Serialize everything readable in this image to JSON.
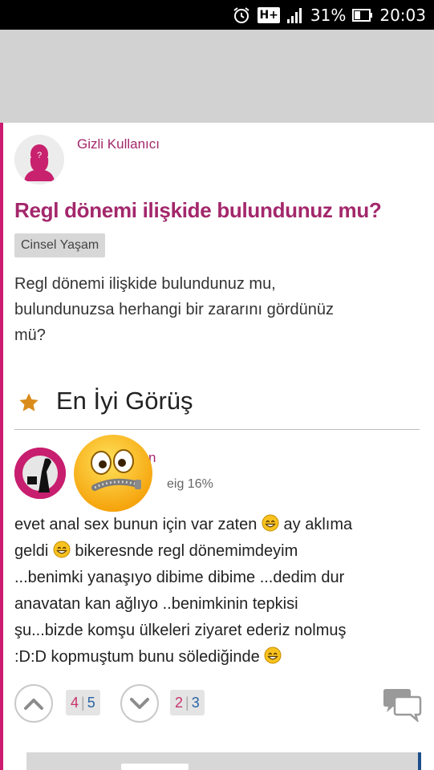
{
  "status_bar": {
    "network": "H+",
    "battery": "31%",
    "time": "20:03"
  },
  "post": {
    "username": "Gizli Kullanıcı",
    "avatar_mark": "?",
    "title": "Regl dönemi ilişkide bulundunuz mu?",
    "category": "Cinsel Yaşam",
    "question_lines": [
      "Regl dönemi ilişkide bulundunuz mu,",
      "bulundunuzsa herhangi bir zararını gördünüz",
      "mü?"
    ]
  },
  "best_answer": {
    "section_title": "En İyi Görüş",
    "author_partial": "n",
    "stat": "eig 16%",
    "lines": [
      [
        "evet anal sex bunun için var zaten ",
        "smiley",
        " ay aklıma"
      ],
      [
        "geldi ",
        "smiley",
        " bikeresnde regl dönemimdeyim"
      ],
      [
        "...benimki yanaşıyo dibime dibime ...dedim dur"
      ],
      [
        "anavatan kan ağlıyo ..benimkinin tepkisi"
      ],
      [
        "şu...bizde komşu ülkeleri ziyaret ederiz nolmuş"
      ],
      [
        ":D:D kopmuştum bunu sölediğinde ",
        "smiley"
      ]
    ],
    "votes": {
      "up": {
        "a": "4",
        "b": "5"
      },
      "down": {
        "a": "2",
        "b": "3"
      }
    }
  },
  "colors": {
    "accent": "#a3276b",
    "pink_line": "#cc1b6f",
    "star": "#d98c1a"
  }
}
